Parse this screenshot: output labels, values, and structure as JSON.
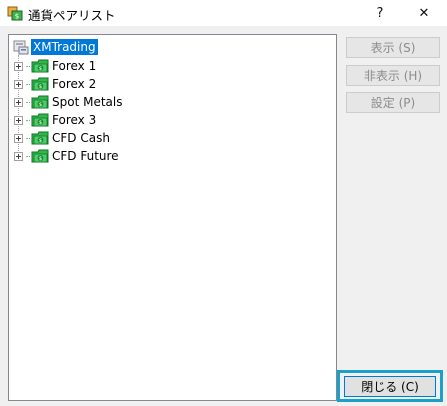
{
  "window": {
    "title": "通貨ペアリスト",
    "help_label": "?",
    "close_label": "✕"
  },
  "tree": {
    "root": {
      "label": "XMTrading",
      "selected": true,
      "icon": "server-icon"
    },
    "items": [
      {
        "label": "Forex 1",
        "icon": "folder-icon",
        "expanded": false
      },
      {
        "label": "Forex 2",
        "icon": "folder-icon",
        "expanded": false
      },
      {
        "label": "Spot Metals",
        "icon": "folder-icon",
        "expanded": false
      },
      {
        "label": "Forex 3",
        "icon": "folder-icon",
        "expanded": false
      },
      {
        "label": "CFD Cash",
        "icon": "folder-icon",
        "expanded": false
      },
      {
        "label": "CFD Future",
        "icon": "folder-icon",
        "expanded": false
      }
    ]
  },
  "buttons": {
    "show": {
      "label": "表示 (S)",
      "enabled": false
    },
    "hide": {
      "label": "非表示 (H)",
      "enabled": false
    },
    "settings": {
      "label": "設定 (P)",
      "enabled": false
    },
    "close": {
      "label": "閉じる (C)",
      "enabled": true,
      "focused": true
    }
  },
  "colors": {
    "selection": "#0078d7",
    "focus_highlight": "#1ba1c9",
    "folder_green": "#2eb84a",
    "disabled_text": "#8c8c8c"
  }
}
